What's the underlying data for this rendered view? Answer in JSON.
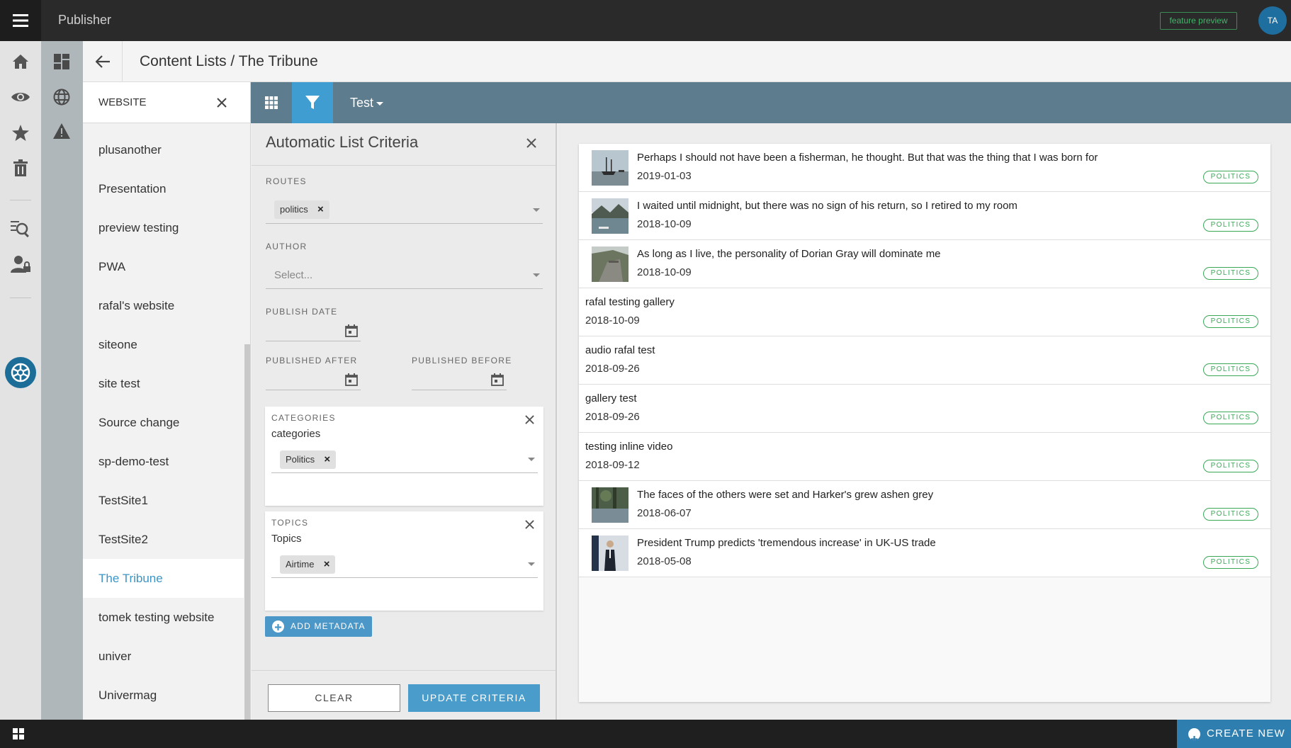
{
  "topbar": {
    "app_title": "Publisher",
    "feature_preview": "feature preview",
    "avatar_initials": "TA"
  },
  "header": {
    "breadcrumb": "Content Lists / The Tribune"
  },
  "sites": {
    "heading": "WEBSITE",
    "items": [
      {
        "label": "plusanother"
      },
      {
        "label": "Presentation"
      },
      {
        "label": "preview testing"
      },
      {
        "label": "PWA"
      },
      {
        "label": "rafal's website"
      },
      {
        "label": "siteone"
      },
      {
        "label": "site test"
      },
      {
        "label": "Source change"
      },
      {
        "label": "sp-demo-test"
      },
      {
        "label": "TestSite1"
      },
      {
        "label": "TestSite2"
      },
      {
        "label": "The Tribune",
        "active": true
      },
      {
        "label": "tomek testing website"
      },
      {
        "label": "univer"
      },
      {
        "label": "Univermag"
      }
    ]
  },
  "toolbar": {
    "list_name": "Test"
  },
  "criteria": {
    "title": "Automatic List Criteria",
    "routes_label": "ROUTES",
    "routes_chip": "politics",
    "author_label": "AUTHOR",
    "author_placeholder": "Select...",
    "publish_date_label": "PUBLISH DATE",
    "published_after_label": "PUBLISHED AFTER",
    "published_before_label": "PUBLISHED BEFORE",
    "categories": {
      "label": "CATEGORIES",
      "sub": "categories",
      "chip": "Politics"
    },
    "topics": {
      "label": "TOPICS",
      "sub": "Topics",
      "chip": "Airtime"
    },
    "add_metadata": "ADD METADATA",
    "clear": "CLEAR",
    "update": "UPDATE CRITERIA"
  },
  "results": [
    {
      "title": "Perhaps I should not have been a fisherman, he thought. But that was the thing that I was born for",
      "date": "2019-01-03",
      "badge": "POLITICS",
      "thumb": "boats"
    },
    {
      "title": "I waited until midnight, but there was no sign of his return, so I retired to my room",
      "date": "2018-10-09",
      "badge": "POLITICS",
      "thumb": "lake"
    },
    {
      "title": "As long as I live, the personality of Dorian Gray will dominate me",
      "date": "2018-10-09",
      "badge": "POLITICS",
      "thumb": "wall"
    },
    {
      "title": "rafal testing gallery",
      "date": "2018-10-09",
      "badge": "POLITICS"
    },
    {
      "title": "audio rafal test",
      "date": "2018-09-26",
      "badge": "POLITICS"
    },
    {
      "title": "gallery test",
      "date": "2018-09-26",
      "badge": "POLITICS"
    },
    {
      "title": "testing inline video",
      "date": "2018-09-12",
      "badge": "POLITICS"
    },
    {
      "title": "The faces of the others were set and Harker's grew ashen grey",
      "date": "2018-06-07",
      "badge": "POLITICS",
      "thumb": "creek"
    },
    {
      "title": "President Trump predicts 'tremendous increase' in UK-US trade",
      "date": "2018-05-08",
      "badge": "POLITICS",
      "thumb": "person"
    }
  ],
  "bottombar": {
    "create_new": "CREATE NEW"
  },
  "colors": {
    "accent": "#3f9dd1",
    "toolbar": "#5d7d8f",
    "badge": "#3aa857",
    "active_site": "#3d95c6"
  }
}
